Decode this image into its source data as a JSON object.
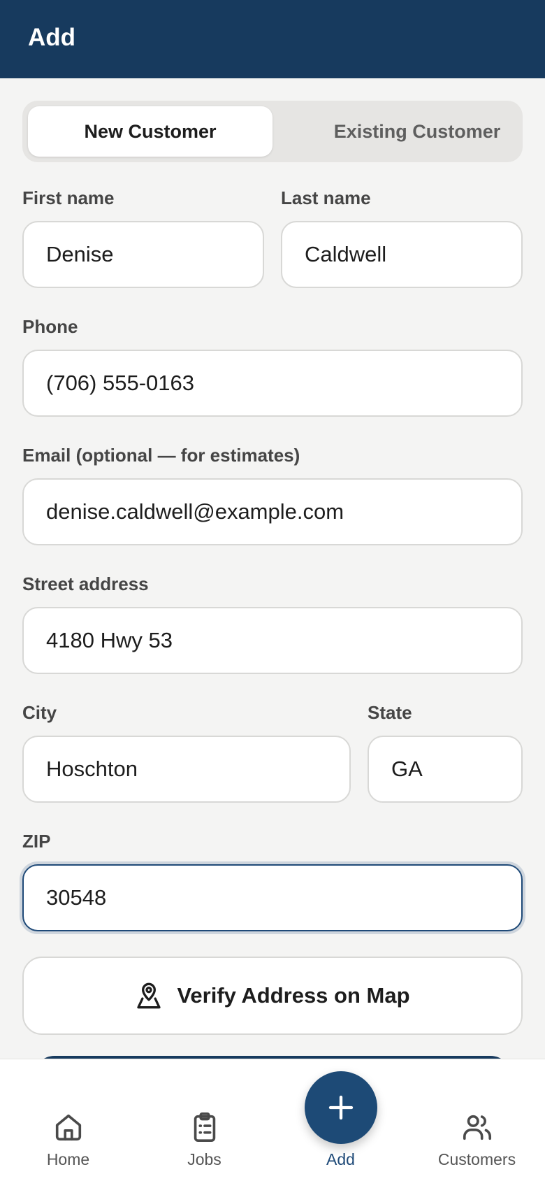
{
  "header": {
    "title": "Add"
  },
  "segment": {
    "new_label": "New Customer",
    "existing_label": "Existing Customer"
  },
  "form": {
    "first_name": {
      "label": "First name",
      "value": "Denise"
    },
    "last_name": {
      "label": "Last name",
      "value": "Caldwell"
    },
    "phone": {
      "label": "Phone",
      "value": "(706) 555-0163"
    },
    "email": {
      "label": "Email (optional — for estimates)",
      "value": "denise.caldwell@example.com"
    },
    "street": {
      "label": "Street address",
      "value": "4180 Hwy 53"
    },
    "city": {
      "label": "City",
      "value": "Hoschton"
    },
    "state": {
      "label": "State",
      "value": "GA"
    },
    "zip": {
      "label": "ZIP",
      "value": "30548"
    }
  },
  "verify_button": {
    "label": "Verify Address on Map",
    "icon": "map-pin-icon"
  },
  "tabbar": {
    "items": [
      {
        "label": "Home",
        "icon": "home-icon"
      },
      {
        "label": "Jobs",
        "icon": "clipboard-icon"
      },
      {
        "label": "Add",
        "icon": "plus-icon"
      },
      {
        "label": "Customers",
        "icon": "users-icon"
      }
    ]
  },
  "colors": {
    "header": "#173a5e",
    "accent": "#1d4a76",
    "background": "#f4f4f3"
  }
}
